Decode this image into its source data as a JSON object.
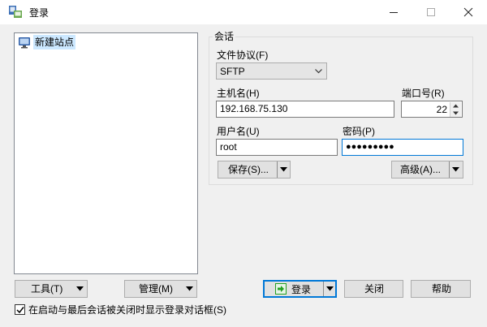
{
  "window": {
    "title": "登录",
    "controls": {
      "minimize": "minimize",
      "maximize": "maximize",
      "close": "close"
    }
  },
  "site_tree": {
    "items": [
      {
        "label": "新建站点",
        "icon": "new-site-icon",
        "selected": true
      }
    ]
  },
  "session": {
    "group_title": "会话",
    "protocol_label": "文件协议(F)",
    "protocol_value": "SFTP",
    "host_label": "主机名(H)",
    "host_value": "192.168.75.130",
    "port_label": "端口号(R)",
    "port_value": "22",
    "user_label": "用户名(U)",
    "user_value": "root",
    "password_label": "密码(P)",
    "password_value": "●●●●●●●●●",
    "save_label": "保存(S)...",
    "advanced_label": "高级(A)..."
  },
  "footer": {
    "tools_label": "工具(T)",
    "manage_label": "管理(M)",
    "login_label": "登录",
    "close_label": "关闭",
    "help_label": "帮助",
    "checkbox_label": "在启动与最后会话被关闭时显示登录对话框(S)",
    "checkbox_checked": true
  },
  "colors": {
    "accent": "#0078d7",
    "selection": "#cce8ff",
    "login_icon": "#22a022"
  }
}
